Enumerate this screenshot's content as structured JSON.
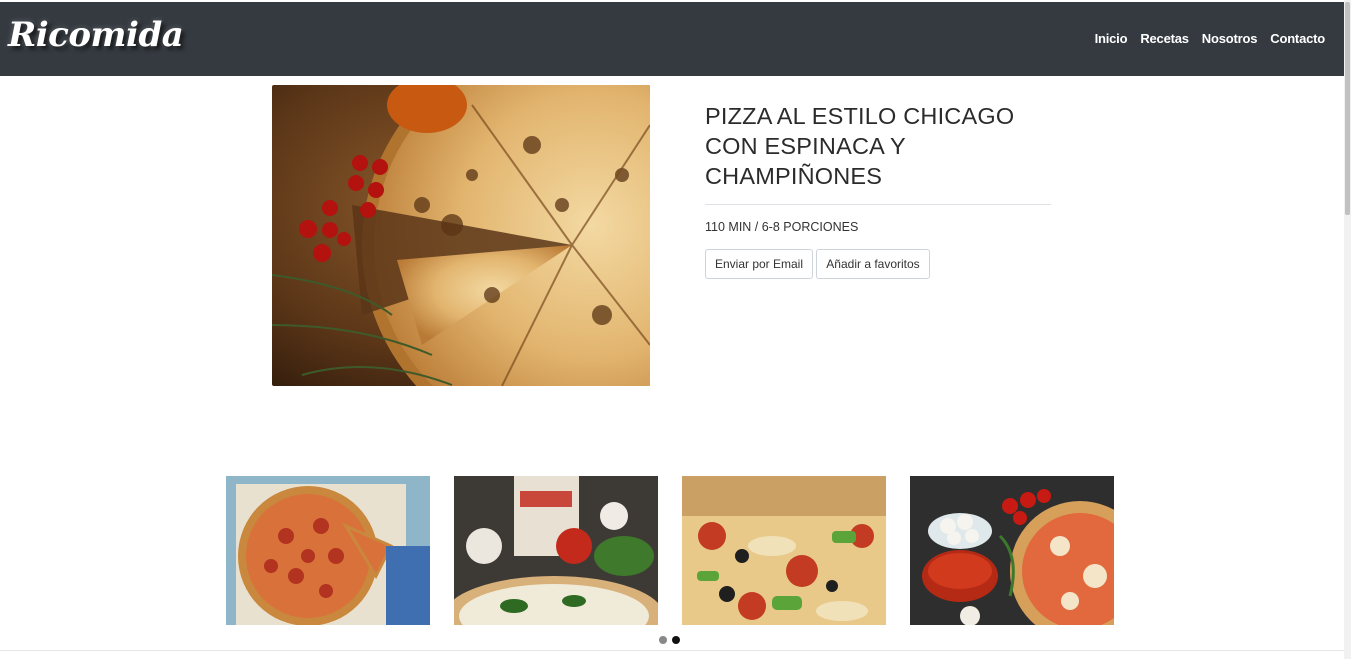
{
  "navbar": {
    "brand": "Ricomida",
    "links": [
      "Inicio",
      "Recetas",
      "Nosotros",
      "Contacto"
    ]
  },
  "recipe": {
    "title": "PIZZA AL ESTILO CHICAGO CON ESPINACA Y CHAMPIÑONES",
    "meta": "110 MIN / 6-8 PORCIONES",
    "buttons": {
      "email": "Enviar por Email",
      "favorites": "Añadir a favoritos"
    }
  },
  "carousel": {
    "slide_count": 2,
    "active_index": 1
  },
  "colors": {
    "navbar_bg": "#343a40",
    "dot_inactive": "#888888",
    "dot_active": "#111111"
  }
}
